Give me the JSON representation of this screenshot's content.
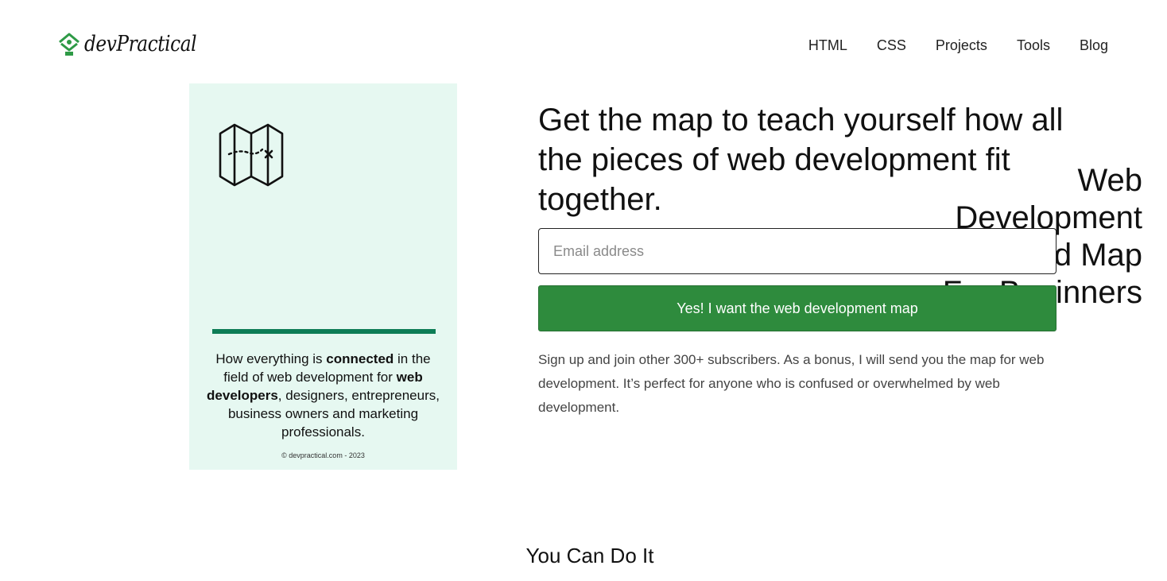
{
  "header": {
    "logo_text": "devPractical",
    "nav": [
      {
        "label": "HTML"
      },
      {
        "label": "CSS"
      },
      {
        "label": "Projects"
      },
      {
        "label": "Tools"
      },
      {
        "label": "Blog"
      }
    ]
  },
  "cover": {
    "title_lines": [
      "Web",
      "Development",
      "Field Map",
      "For Beginners"
    ],
    "desc": {
      "p1": "How everything is ",
      "b1": "connected",
      "p2": " in the field of web development for ",
      "b2": "web developers",
      "p3": ", designers, entrepreneurs, business owners and marketing professionals."
    },
    "copyright": "© devpractical.com - 2023",
    "accent_color": "#0d7d56",
    "bg_color": "#e6f8f1"
  },
  "signup": {
    "headline": "Get the map to teach yourself how all the pieces of web development fit together.",
    "email_placeholder": "Email address",
    "email_value": "",
    "button_label": "Yes! I want the web development map",
    "button_color": "#2e8b3d",
    "description": "Sign up and join other 300+ subscribers. As a bonus, I will send you the map for web development. It’s perfect for anyone who is confused or overwhelmed by web development."
  },
  "section": {
    "heading": "You Can Do It"
  }
}
